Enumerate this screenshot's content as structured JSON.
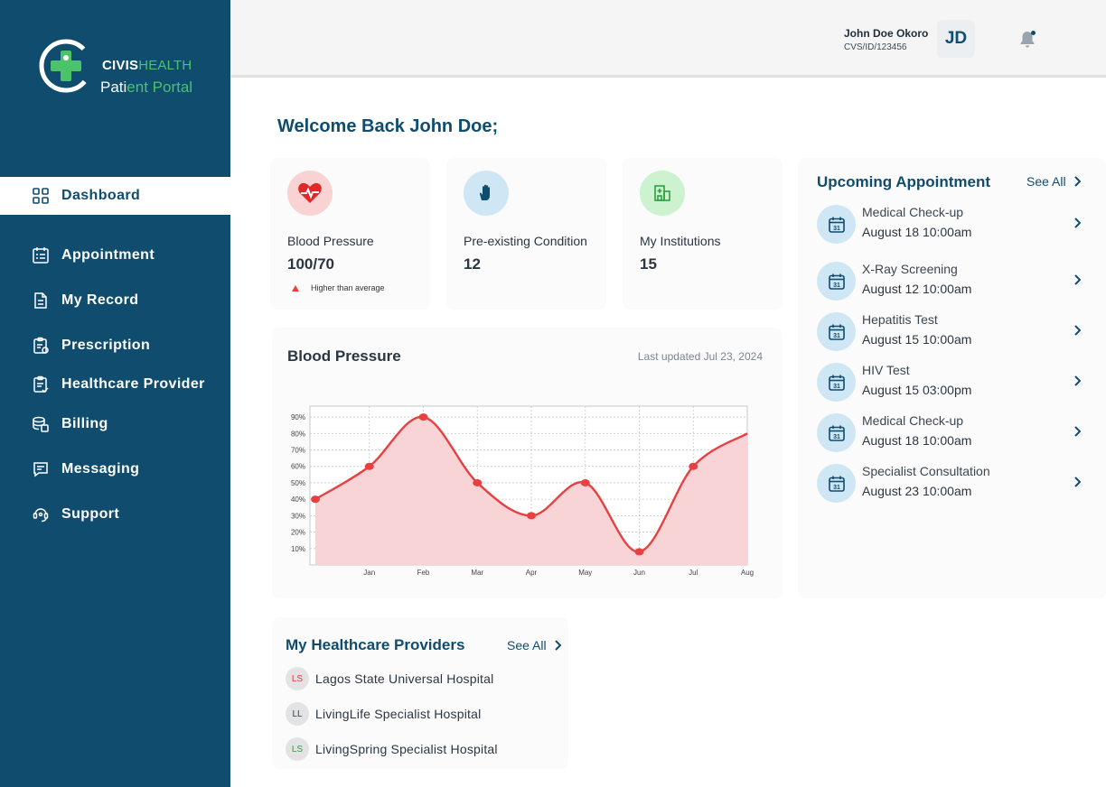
{
  "brand": {
    "name_part1": "CIVIS",
    "name_part2": "HEALTH",
    "subtitle_part1": "Pati",
    "subtitle_part2": "ent Portal"
  },
  "nav": {
    "items": [
      {
        "label": "Dashboard",
        "icon": "grid-icon",
        "active": true
      },
      {
        "label": "Appointment",
        "icon": "calendar-list-icon"
      },
      {
        "label": "My Record",
        "icon": "document-icon"
      },
      {
        "label": "Prescription",
        "icon": "prescription-icon"
      },
      {
        "label": "Healthcare Provider",
        "icon": "clipboard-icon"
      },
      {
        "label": "Billing",
        "icon": "billing-icon"
      },
      {
        "label": "Messaging",
        "icon": "message-icon"
      },
      {
        "label": "Support",
        "icon": "support-icon"
      }
    ]
  },
  "header": {
    "user_name": "John Doe Okoro",
    "user_id": "CVS/ID/123456",
    "avatar_initials": "JD",
    "notification_icon": "bell-icon"
  },
  "welcome": "Welcome Back John Doe;",
  "stats": [
    {
      "label": "Blood Pressure",
      "value": "100/70",
      "note": "Higher than average",
      "icon": "heart-pulse-icon",
      "color": "#e84040"
    },
    {
      "label": "Pre-existing Condition",
      "value": "12",
      "icon": "hand-icon",
      "color": "#0f4c6e"
    },
    {
      "label": "My Institutions",
      "value": "15",
      "icon": "hospital-icon",
      "color": "#2ea043"
    }
  ],
  "bp_card": {
    "title": "Blood Pressure",
    "updated": "Last updated Jul 23, 2024"
  },
  "chart_data": {
    "type": "area",
    "x": [
      "",
      "Jan",
      "Feb",
      "Mar",
      "Apr",
      "May",
      "Jun",
      "Jul",
      "Aug"
    ],
    "values": [
      40,
      60,
      90,
      50,
      30,
      50,
      8,
      60,
      80
    ],
    "y_ticks": [
      "10%",
      "20%",
      "30%",
      "40%",
      "50%",
      "60%",
      "70%",
      "80%",
      "90%"
    ],
    "ylim": [
      0,
      95
    ],
    "grid": true,
    "color": "#e84040",
    "fill": "#f9d2d4"
  },
  "appointments": {
    "title": "Upcoming Appointment",
    "see_all": "See All",
    "items": [
      {
        "name": "Medical Check-up",
        "time": "August 18  10:00am"
      },
      {
        "name": "X-Ray Screening",
        "time": "August 12  10:00am"
      },
      {
        "name": "Hepatitis Test",
        "time": "August 15  10:00am"
      },
      {
        "name": "HIV Test",
        "time": "August 15  03:00pm"
      },
      {
        "name": "Medical Check-up",
        "time": "August 18  10:00am"
      },
      {
        "name": "Specialist Consultation",
        "time": "August 23  10:00am"
      }
    ],
    "calendar_day": "31"
  },
  "providers": {
    "title": "My Healthcare Providers",
    "see_all": "See All",
    "items": [
      {
        "initials": "LS",
        "name": "Lagos State Universal Hospital",
        "color": "#d63a3a"
      },
      {
        "initials": "LL",
        "name": "LivingLife Specialist Hospital",
        "color": "#3a4650"
      },
      {
        "initials": "LS",
        "name": "LivingSpring Specialist Hospital",
        "color": "#2ea043"
      }
    ]
  }
}
